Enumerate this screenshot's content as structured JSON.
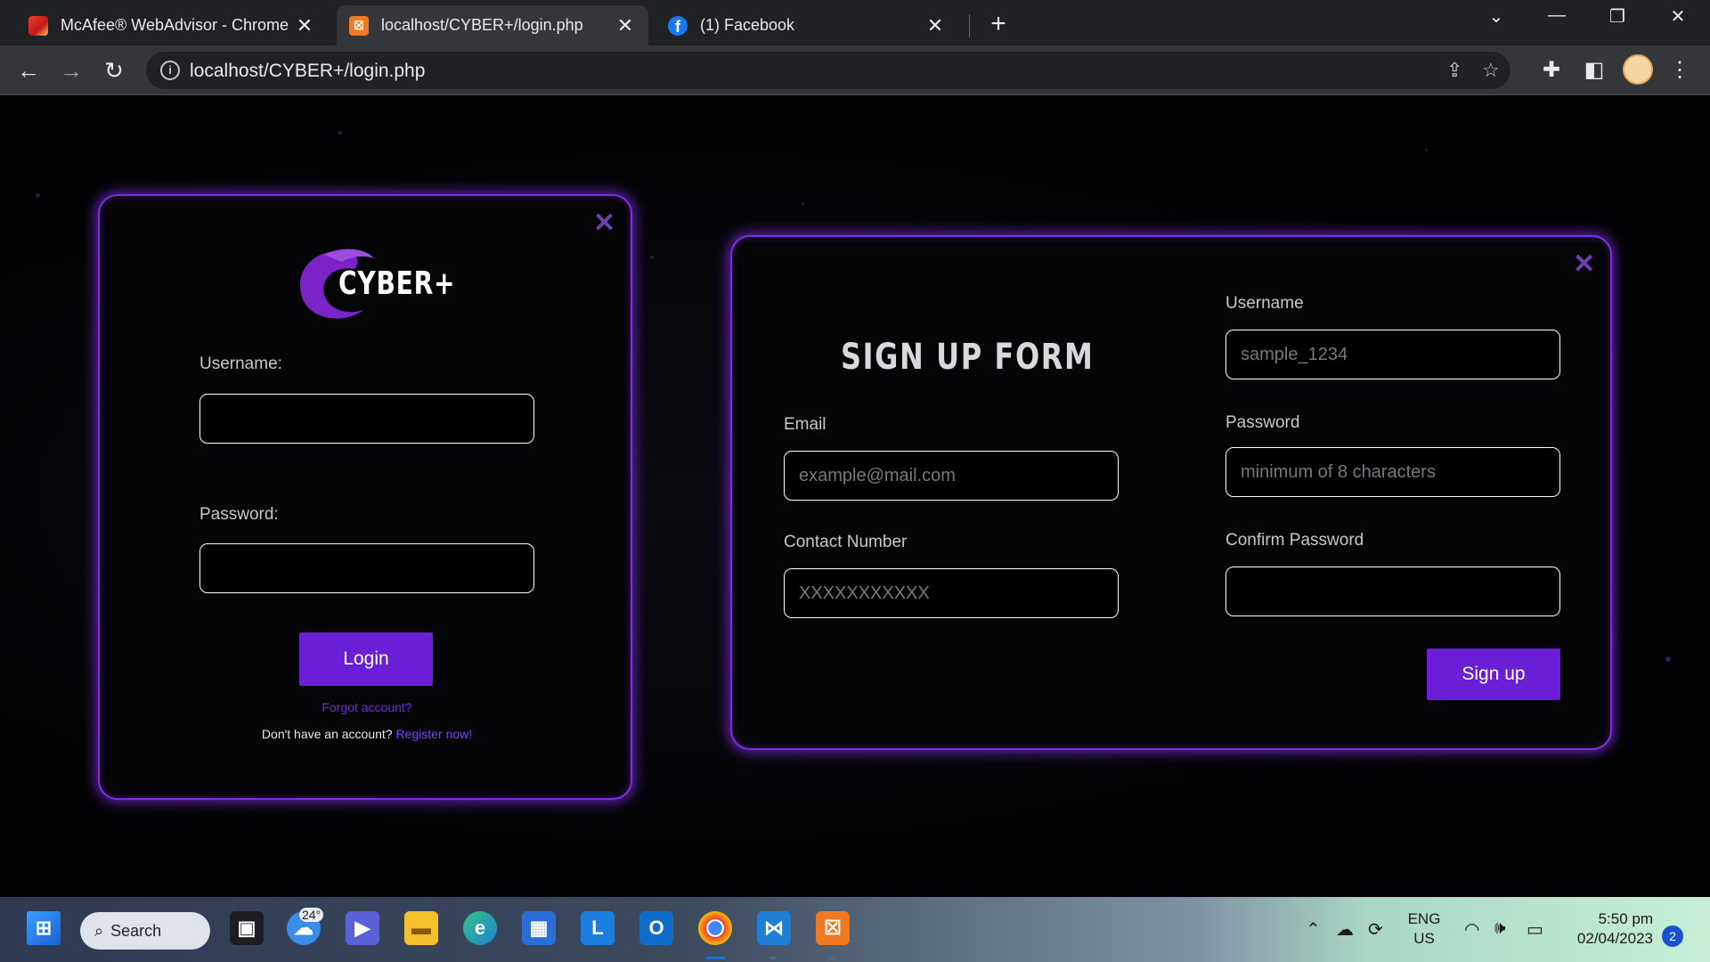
{
  "browser": {
    "tabs": [
      {
        "title": "McAfee® WebAdvisor - Chrome",
        "active": false,
        "favicon_color": "#c01818"
      },
      {
        "title": "localhost/CYBER+/login.php",
        "active": true,
        "favicon_color": "#f07a24"
      },
      {
        "title": "(1) Facebook",
        "active": false,
        "favicon_color": "#1877f2"
      }
    ],
    "new_tab": "+",
    "url": "localhost/CYBER+/login.php"
  },
  "login_card": {
    "logo_text": "CYBER+",
    "username_label": "Username:",
    "username_value": "",
    "password_label": "Password:",
    "password_value": "",
    "login_button": "Login",
    "forgot_link": "Forgot account?",
    "no_account_text": "Don't have an account?",
    "register_link": "Register now!",
    "close": "✕"
  },
  "signup_card": {
    "heading": "SIGN UP FORM",
    "email_label": "Email",
    "email_placeholder": "example@mail.com",
    "contact_label": "Contact Number",
    "contact_placeholder": "XXXXXXXXXXX",
    "username_label": "Username",
    "username_placeholder": "sample_1234",
    "password_label": "Password",
    "password_placeholder": "minimum of 8 characters",
    "confirm_label": "Confirm Password",
    "confirm_value": "",
    "signup_button": "Sign up",
    "close": "✕"
  },
  "taskbar": {
    "search_label": "Search",
    "weather_temp": "24°",
    "language_top": "ENG",
    "language_bottom": "US",
    "time": "5:50 pm",
    "date": "02/04/2023",
    "notification_count": "2"
  },
  "colors": {
    "accent": "#6a1fd6",
    "card_border": "#7a2fe0",
    "link": "#7b3ff2"
  }
}
